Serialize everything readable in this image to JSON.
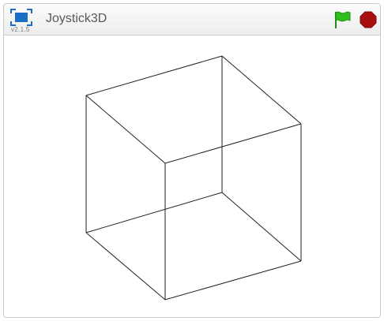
{
  "header": {
    "title": "Joystick3D",
    "version": "v2.1.5",
    "app_icon": "fullscreen-icon",
    "green_flag_icon": "green-flag-icon",
    "stop_icon": "stop-sign-icon"
  },
  "colors": {
    "accent_blue": "#1a6fc4",
    "flag_green": "#2fbf1f",
    "stop_red": "#a80f0f",
    "cube_line": "#222222"
  },
  "stage": {
    "drawing": "wireframe-cube"
  }
}
